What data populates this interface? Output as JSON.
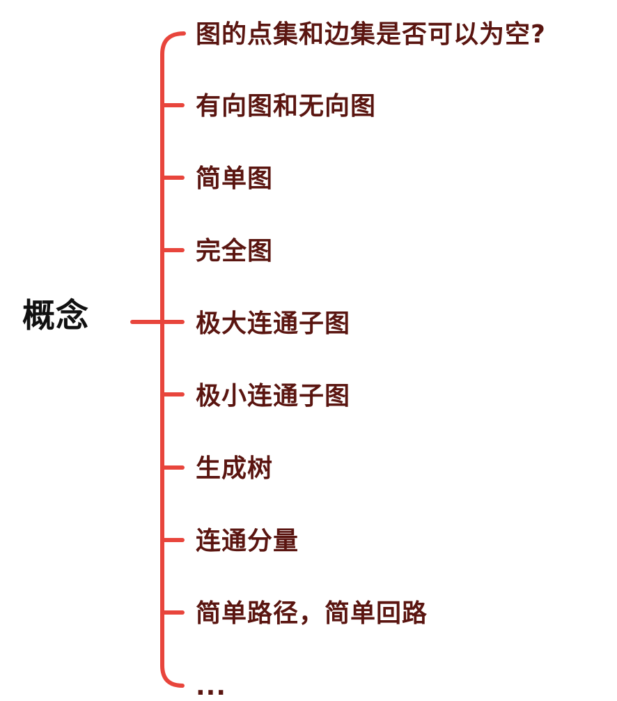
{
  "root": {
    "label": "概念"
  },
  "branches": [
    {
      "label": "图的点集和边集是否可以为空?"
    },
    {
      "label": "有向图和无向图"
    },
    {
      "label": "简单图"
    },
    {
      "label": "完全图"
    },
    {
      "label": "极大连通子图"
    },
    {
      "label": "极小连通子图"
    },
    {
      "label": "生成树"
    },
    {
      "label": "连通分量"
    },
    {
      "label": "简单路径，简单回路"
    },
    {
      "label": "..."
    }
  ],
  "colors": {
    "connector": "#e8453c",
    "root_text": "#111111",
    "branch_text": "#5a1510",
    "background": "#ffffff"
  }
}
